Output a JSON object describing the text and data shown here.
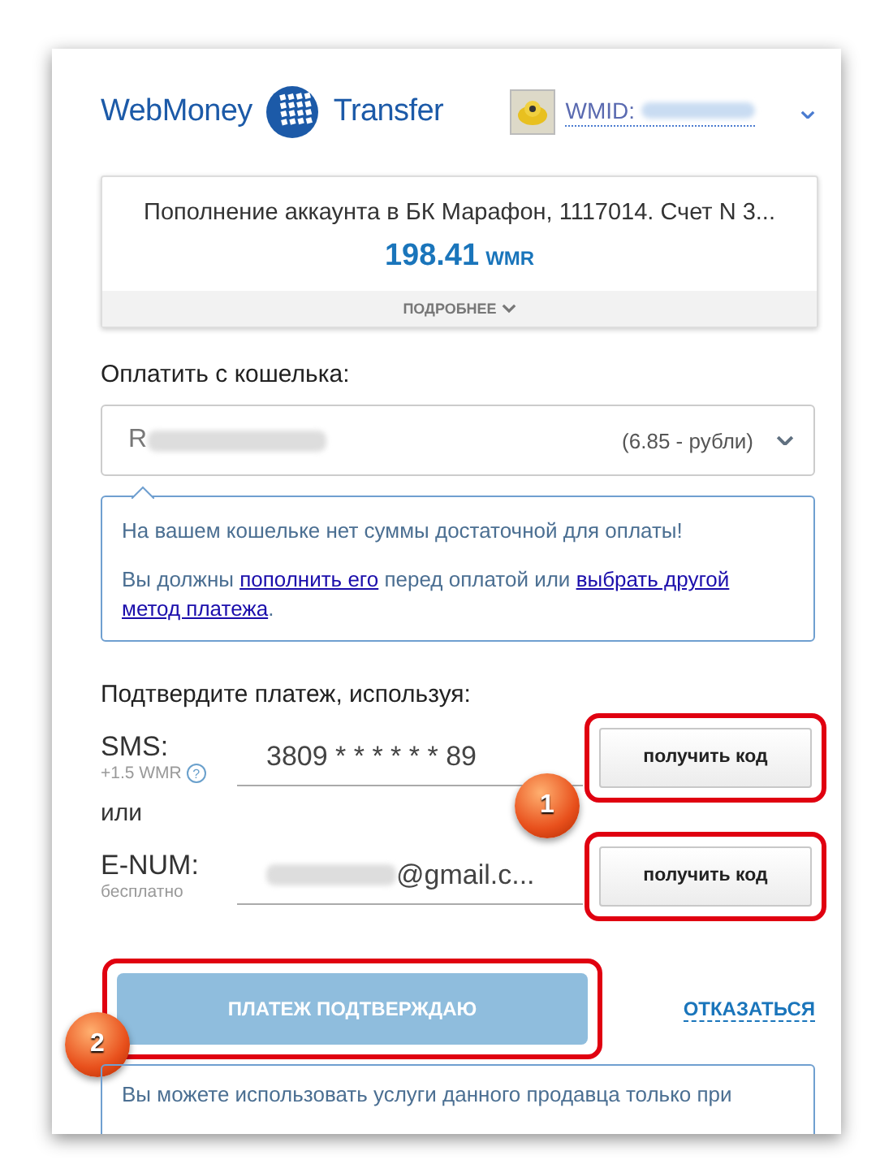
{
  "header": {
    "logo_left": "WebMoney",
    "logo_right": "Transfer",
    "wmid_label": "WMID:"
  },
  "invoice": {
    "description": "Пополнение аккаунта в БК Марафон, 1117014. Счет N 3...",
    "amount": "198.41",
    "currency": "WMR",
    "details": "ПОДРОБНЕЕ"
  },
  "wallet": {
    "label": "Оплатить с кошелька:",
    "prefix": "R",
    "balance": "(6.85 - рубли)"
  },
  "notice": {
    "line1": "На вашем кошельке нет суммы достаточной для оплаты!",
    "line2_start": "Вы должны ",
    "link1": "пополнить его",
    "line2_mid": " перед оплатой или ",
    "link2_a": "выбрать другой",
    "link2_b": "метод платежа",
    "line2_end": "."
  },
  "confirm": {
    "label": "Подтвердите платеж, используя:",
    "methods": [
      {
        "kind": "sms",
        "name": "SMS:",
        "note": "+1.5 WMR",
        "help": "?",
        "value": "3809 * * * * * * 89",
        "button": "получить код",
        "highlighted": true,
        "marker": "1"
      },
      {
        "kind": "enum",
        "name": "E-NUM:",
        "note": "бесплатно",
        "value": "@gmail.c...",
        "button": "получить код",
        "highlighted": true
      }
    ],
    "or": "или"
  },
  "actions": {
    "submit": "ПЛАТЕЖ ПОДТВЕРЖДАЮ",
    "disabled": true,
    "highlighted": true,
    "marker": "2",
    "cancel": "ОТКАЗАТЬСЯ"
  },
  "footer_notice": "Вы можете использовать услуги данного продавца только при"
}
